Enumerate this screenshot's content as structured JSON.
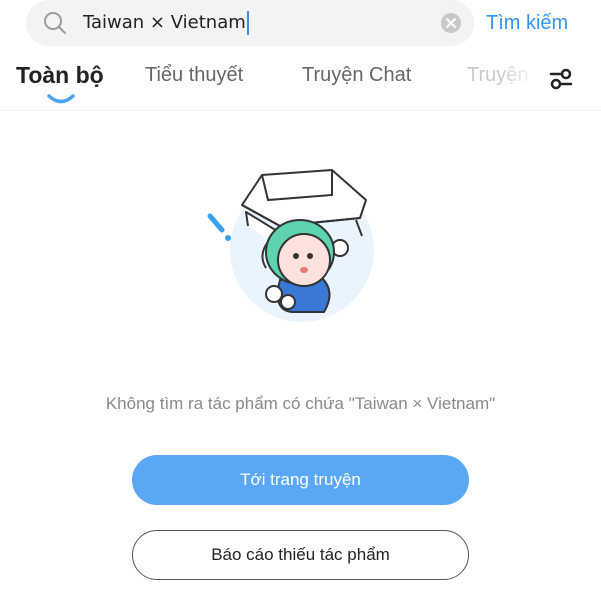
{
  "search": {
    "value": "Taiwan × Vietnam",
    "button_label": "Tìm kiếm"
  },
  "tabs": [
    {
      "label": "Toàn bộ",
      "active": true
    },
    {
      "label": "Tiểu thuyết",
      "active": false
    },
    {
      "label": "Truyện Chat",
      "active": false
    },
    {
      "label": "Truyện",
      "active": false
    }
  ],
  "empty_state": {
    "message": "Không tìm ra tác phẩm có chứa \"Taiwan × Vietnam\"",
    "primary_button": "Tới trang truyện",
    "secondary_button": "Báo cáo thiếu tác phẩm"
  },
  "colors": {
    "accent": "#2f97f1",
    "primary_button_bg": "#5aa8f5",
    "search_bg": "#f2f3f5"
  },
  "icons": [
    "search-icon",
    "clear-icon",
    "filter-icon",
    "tab-indicator",
    "empty-illustration"
  ]
}
